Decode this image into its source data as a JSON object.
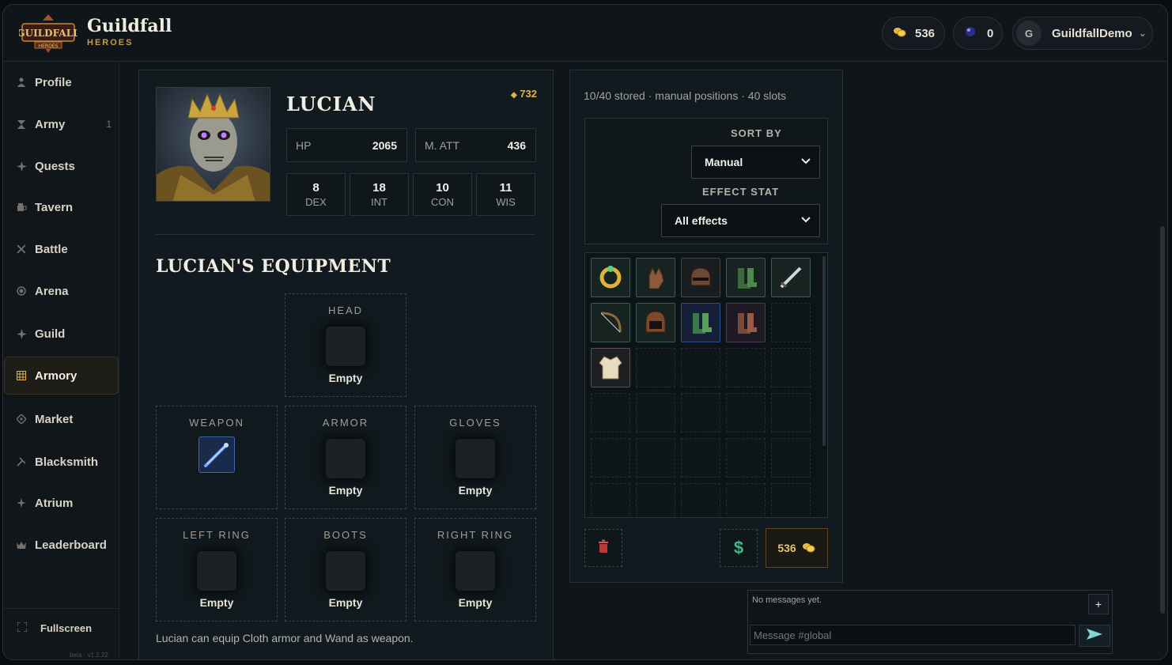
{
  "app": {
    "name": "Guildfall",
    "subtitle": "HEROES",
    "logo_text": "GUILDFALL HEROES"
  },
  "header": {
    "gold": "536",
    "gems": "0",
    "avatar_initial": "G",
    "username": "GuildfallDemo",
    "dropdown_glyph": "⌄"
  },
  "sidebar": {
    "items": [
      {
        "label": "Profile",
        "icon": "person-icon",
        "badge": ""
      },
      {
        "label": "Army",
        "icon": "hourglass-icon",
        "badge": "1"
      },
      {
        "label": "Quests",
        "icon": "compass-icon",
        "badge": ""
      },
      {
        "label": "Tavern",
        "icon": "tavern-icon",
        "badge": ""
      },
      {
        "label": "Battle",
        "icon": "swords-icon",
        "badge": ""
      },
      {
        "label": "Arena",
        "icon": "target-icon",
        "badge": ""
      },
      {
        "label": "Guild",
        "icon": "guild-icon",
        "badge": ""
      },
      {
        "label": "Armory",
        "icon": "armory-icon",
        "badge": "",
        "active": true
      },
      {
        "label": "Market",
        "icon": "market-icon",
        "badge": ""
      },
      {
        "label": "Blacksmith",
        "icon": "hammer-icon",
        "badge": ""
      },
      {
        "label": "Atrium",
        "icon": "star-icon",
        "badge": ""
      },
      {
        "label": "Leaderboard",
        "icon": "crown-icon",
        "badge": ""
      }
    ],
    "fullscreen": "Fullscreen",
    "version": "beta · v1.2.22"
  },
  "hero": {
    "name": "LUCIAN",
    "power": "732",
    "stats": [
      {
        "key": "HP",
        "value": "2065"
      },
      {
        "key": "M. ATT",
        "value": "436"
      }
    ],
    "attributes": [
      {
        "value": "8",
        "key": "DEX"
      },
      {
        "value": "18",
        "key": "INT"
      },
      {
        "value": "10",
        "key": "CON"
      },
      {
        "value": "11",
        "key": "WIS"
      }
    ]
  },
  "equipment": {
    "title": "LUCIAN'S EQUIPMENT",
    "slots": {
      "head": {
        "label": "HEAD",
        "status": "Empty"
      },
      "weapon": {
        "label": "WEAPON",
        "item": "wand"
      },
      "armor": {
        "label": "ARMOR",
        "status": "Empty"
      },
      "gloves": {
        "label": "GLOVES",
        "status": "Empty"
      },
      "left_ring": {
        "label": "LEFT RING",
        "status": "Empty"
      },
      "boots": {
        "label": "BOOTS",
        "status": "Empty"
      },
      "right_ring": {
        "label": "RIGHT RING",
        "status": "Empty"
      }
    },
    "note": "Lucian can equip Cloth armor and Wand as weapon."
  },
  "inventory": {
    "info": "10/40 stored · manual positions · 40 slots",
    "sort_label": "SORT BY",
    "sort_value": "Manual",
    "effect_label": "EFFECT STAT",
    "effect_value": "All effects",
    "items": [
      "ring-item",
      "gloves-item",
      "helmet-item",
      "boots-item",
      "sword-item",
      "bow-item",
      "helmet-item",
      "boots-item",
      "boots-item",
      "robe-item"
    ],
    "gold": "536"
  },
  "chat": {
    "empty": "No messages yet.",
    "plus": "+",
    "placeholder": "Message #global"
  }
}
